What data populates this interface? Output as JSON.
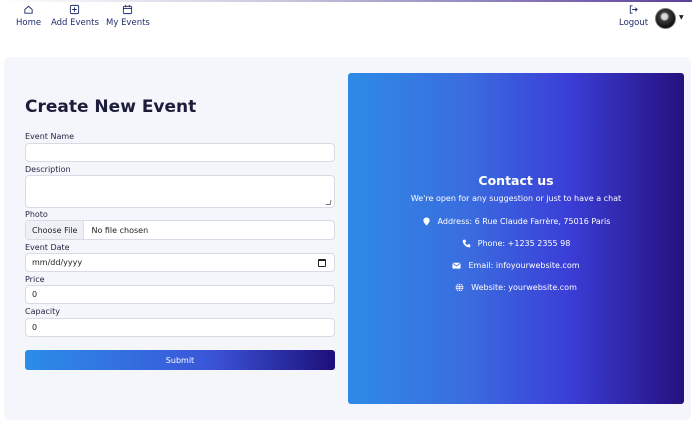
{
  "nav": {
    "items": [
      {
        "label": "Home",
        "icon": "home-icon"
      },
      {
        "label": "Add Events",
        "icon": "plus-square-icon"
      },
      {
        "label": "My Events",
        "icon": "calendar-icon"
      }
    ],
    "logout": {
      "label": "Logout",
      "icon": "logout-icon"
    }
  },
  "form": {
    "title": "Create New Event",
    "event_name": {
      "label": "Event Name",
      "value": ""
    },
    "description": {
      "label": "Description",
      "value": ""
    },
    "photo": {
      "label": "Photo",
      "button": "Choose File",
      "status": "No file chosen"
    },
    "event_date": {
      "label": "Event Date",
      "placeholder": "mm/dd/yyyy"
    },
    "price": {
      "label": "Price",
      "value": "0"
    },
    "capacity": {
      "label": "Capacity",
      "value": "0"
    },
    "submit": "Submit"
  },
  "contact": {
    "title": "Contact us",
    "subtitle": "We're open for any suggestion or just to have a chat",
    "address": "Address: 6 Rue Claude Farrère, 75016 Paris",
    "phone": "Phone: +1235 2355 98",
    "email": "Email: infoyourwebsite.com",
    "website": "Website: yourwebsite.com"
  },
  "colors": {
    "gradient_start": "#2d8be6",
    "gradient_end": "#25107f",
    "nav_text": "#1f2d6b",
    "card_bg": "#f5f6fb"
  }
}
